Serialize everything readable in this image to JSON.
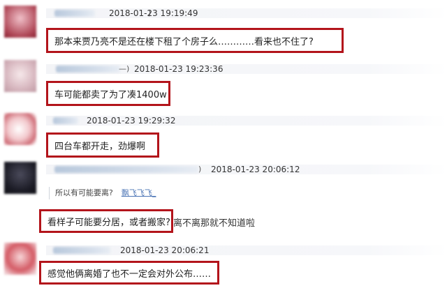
{
  "comments": [
    {
      "name_tail": ")",
      "timestamp": "2018-01-23 19:19:49",
      "text": "那本来贾乃亮不是还在楼下租了个房子么…………看来也不住了?"
    },
    {
      "name_tail": "—)",
      "timestamp": "2018-01-23 19:23:36",
      "text": "车可能都卖了为了凑1400w"
    },
    {
      "name_tail": "",
      "timestamp": "2018-01-23 19:29:32",
      "text": "四台车都开走，劲爆啊"
    },
    {
      "name_tail": ")",
      "timestamp": "2018-01-23 20:06:12",
      "quote_text": "所以有可能要离?",
      "quote_user": "飘飞飞飞_",
      "text": "看样子可能要分居，或者搬家?",
      "extra": "离不离那就不知道啦"
    },
    {
      "name_tail": "",
      "timestamp": "2018-01-23 20:06:21",
      "text": "感觉他俩离婚了也不一定会对外公布……"
    }
  ],
  "colors": {
    "highlight_border": "#b3141b",
    "link": "#4b74b5"
  }
}
